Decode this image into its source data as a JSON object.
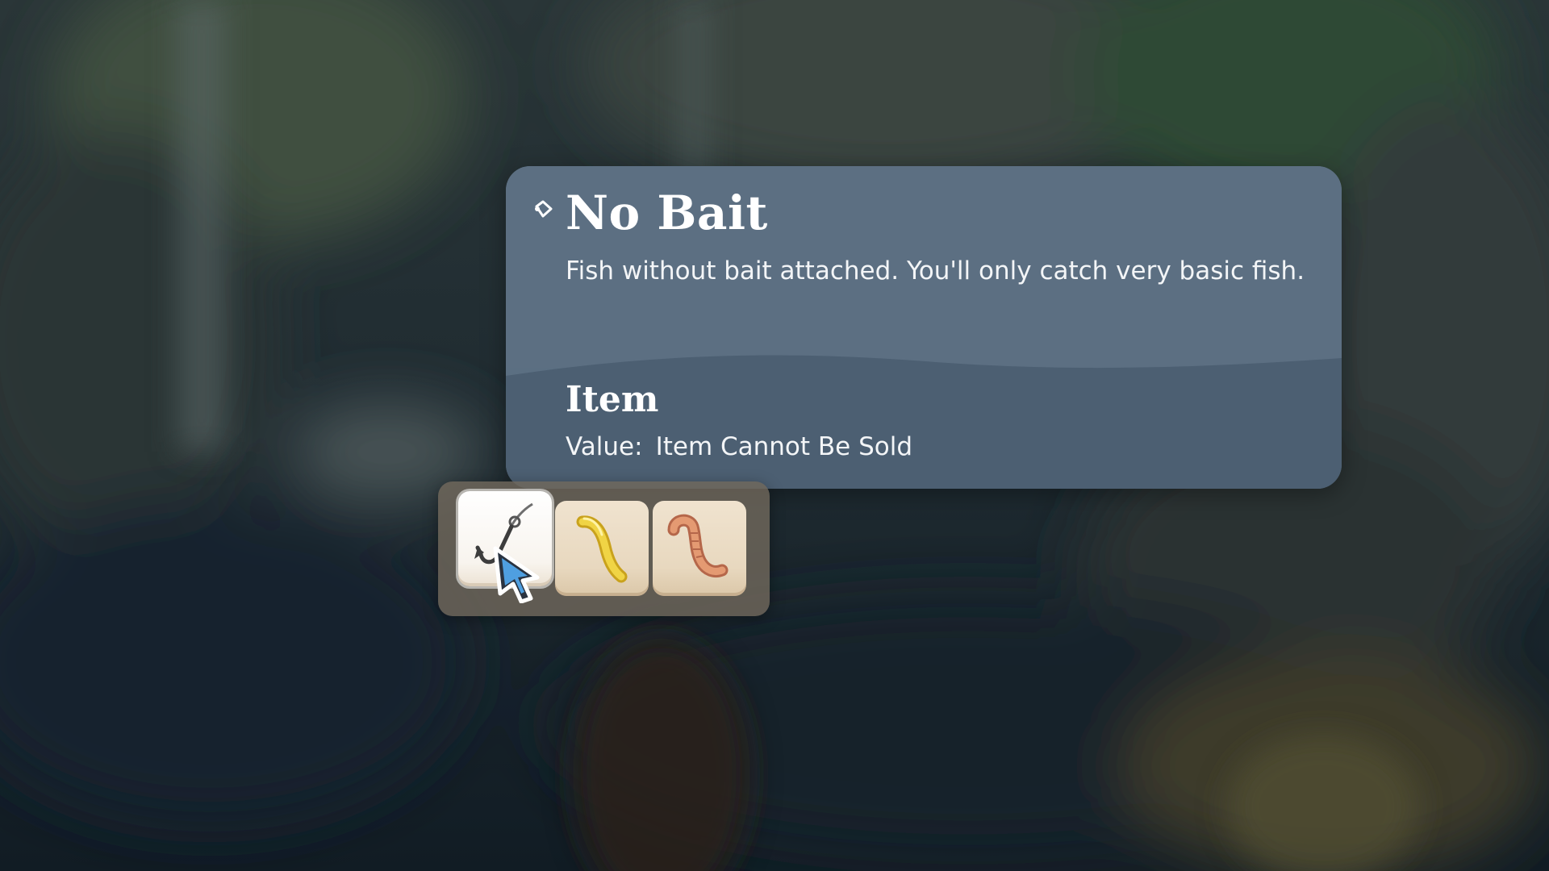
{
  "tooltip": {
    "title": "No Bait",
    "description": "Fish without bait attached. You'll only catch very basic fish.",
    "category": "Item",
    "value_label": "Value:",
    "value": "Item Cannot Be Sold",
    "icon": "pin-icon"
  },
  "bait_bar": {
    "slots": [
      {
        "name": "No Bait",
        "icon": "fishing-hook-icon",
        "selected": true
      },
      {
        "name": "Yellow worm bait",
        "icon": "yellow-worm-icon",
        "selected": false
      },
      {
        "name": "Pink worm bait",
        "icon": "pink-worm-icon",
        "selected": false
      }
    ]
  },
  "cursor": {
    "icon": "pointer-cursor-icon"
  },
  "colors": {
    "tooltip_top": "#5c6f82",
    "tooltip_bottom": "#4c5f72",
    "slot_bg": "#efe2cd",
    "bar_bg": "#70685c",
    "worm_yellow": "#e8c93a",
    "worm_pink": "#e0936b"
  }
}
